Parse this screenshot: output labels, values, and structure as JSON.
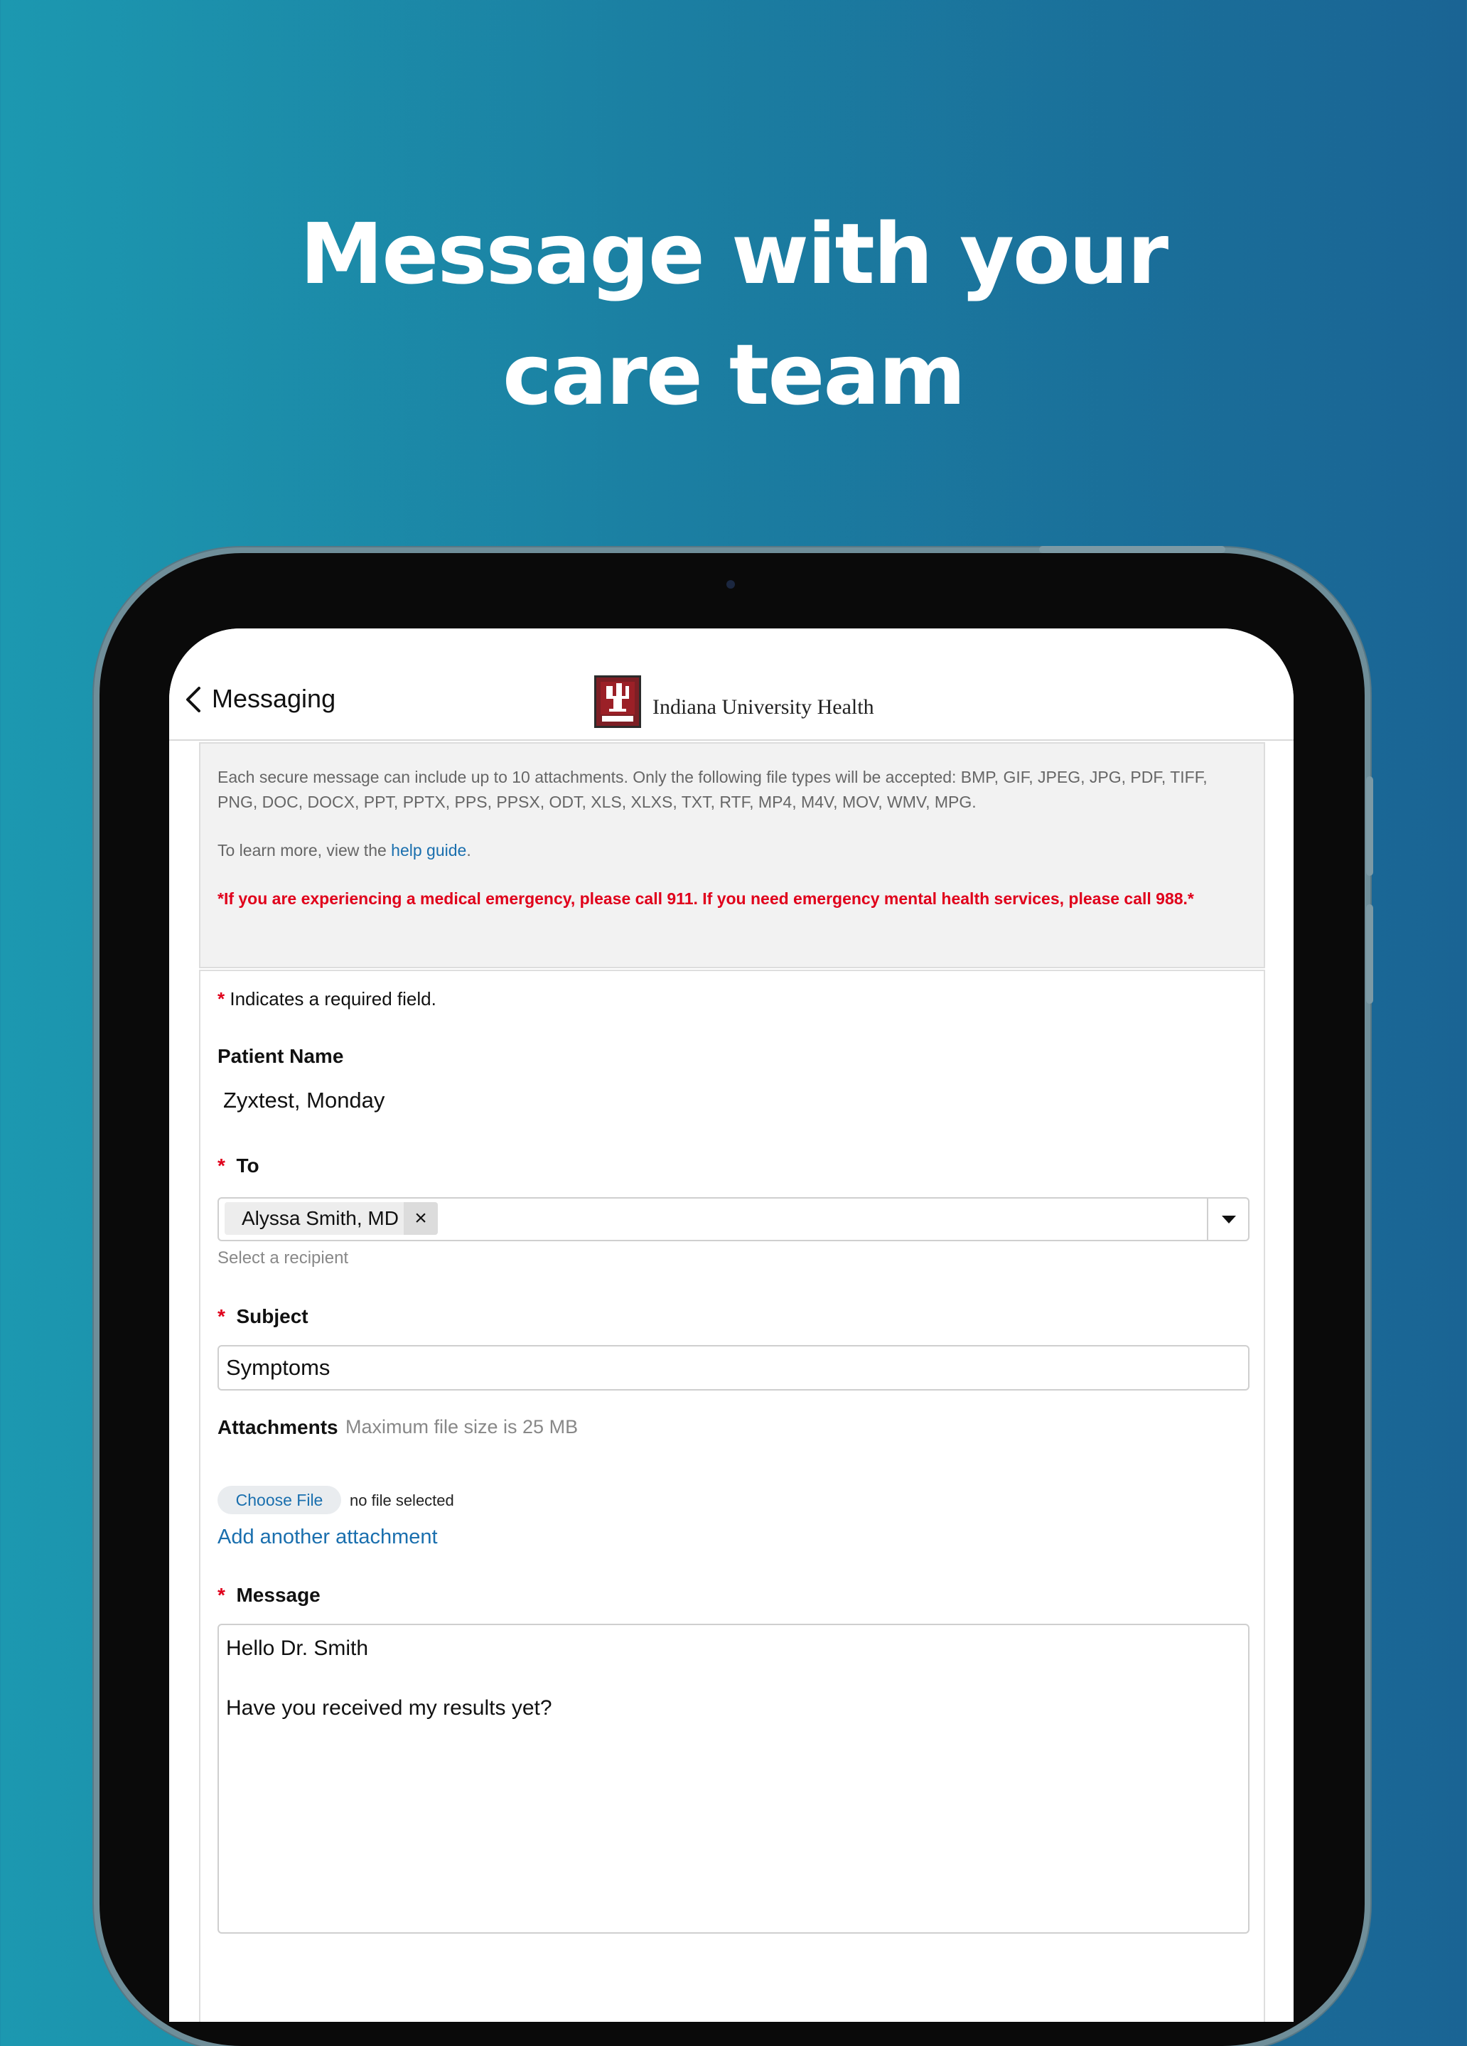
{
  "headline": {
    "line1": "Message with your",
    "line2": "care team"
  },
  "nav": {
    "back_label": "Messaging",
    "logo_text": "Indiana University Health",
    "back_icon": "chevron-left-icon",
    "logo_icon": "iu-trident-logo"
  },
  "info": {
    "attachments_text": "Each secure message can include up to 10 attachments. Only the following file types will be accepted: BMP, GIF, JPEG, JPG, PDF, TIFF, PNG, DOC, DOCX, PPT, PPTX, PPS, PPSX, ODT, XLS, XLXS, TXT, RTF, MP4, M4V, MOV, WMV, MPG.",
    "learn_prefix": "To learn more, view the ",
    "help_link": "help guide",
    "learn_suffix": ".",
    "emergency": "*If you are experiencing a medical emergency, please call 911. If you need emergency mental health services, please call 988.*"
  },
  "form": {
    "required_star": "*",
    "required_note": " Indicates a required field.",
    "patient_label": "Patient Name",
    "patient_value": "Zyxtest, Monday",
    "to_label": "To",
    "recipient_chip": "Alyssa Smith, MD",
    "recipient_remove": "×",
    "recipient_hint": "Select a recipient",
    "subject_label": "Subject",
    "subject_value": "Symptoms",
    "attachments_label": "Attachments",
    "attachments_hint": "Maximum file size is 25 MB",
    "choose_file": "Choose File",
    "no_file": "no file selected",
    "add_attachment": "Add another attachment",
    "message_label": "Message",
    "message_line1": "Hello Dr. Smith",
    "message_line2": "Have you received my results yet?"
  },
  "colors": {
    "background_left": "#1c98b0",
    "background_right": "#1a6494",
    "link": "#1a6fae",
    "required": "#e0001b",
    "logo_crimson": "#7d1f25"
  }
}
